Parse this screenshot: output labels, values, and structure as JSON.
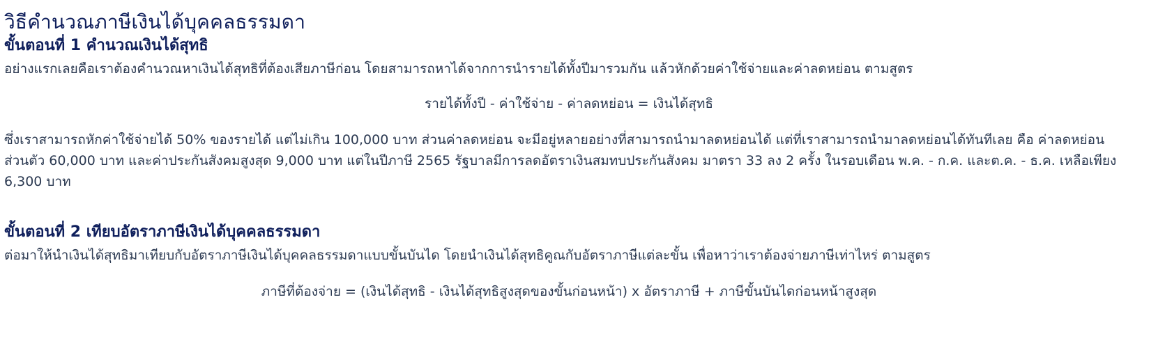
{
  "title": "วิธีคำนวณภาษีเงินได้บุคคลธรรมดา",
  "step1": {
    "heading": "ขั้นตอนที่ 1 คำนวณเงินได้สุทธิ",
    "intro": "อย่างแรกเลยคือเราต้องคำนวณหาเงินได้สุทธิที่ต้องเสียภาษีก่อน โดยสามารถหาได้จากการนำรายได้ทั้งปีมารวมกัน แล้วหักด้วยค่าใช้จ่ายและค่าลดหย่อน ตามสูตร",
    "formula": "รายได้ทั้งปี - ค่าใช้จ่าย - ค่าลดหย่อน = เงินได้สุทธิ",
    "detail_line1": "ซึ่งเราสามารถหักค่าใช้จ่ายได้ 50% ของรายได้ แต่ไม่เกิน 100,000 บาท ส่วนค่าลดหย่อน จะมีอยู่หลายอย่างที่สามารถนำมาลดหย่อนได้ แต่ที่เราสามารถนำมาลดหย่อนได้ทันทีเลย คือ ค่าลดหย่อน",
    "detail_line2": "ส่วนตัว 60,000 บาท และค่าประกันสังคมสูงสุด 9,000 บาท แต่ในปีภาษี 2565 รัฐบาลมีการลดอัตราเงินสมทบประกันสังคม มาตรา 33 ลง 2 ครั้ง ในรอบเดือน พ.ค. - ก.ค. และต.ค. - ธ.ค. เหลือเพียง",
    "detail_line3": "6,300 บาท"
  },
  "step2": {
    "heading": "ขั้นตอนที่ 2 เทียบอัตราภาษีเงินได้บุคคลธรรมดา",
    "intro": "ต่อมาให้นำเงินได้สุทธิมาเทียบกับอัตราภาษีเงินได้บุคคลธรรมดาแบบขั้นบันได โดยนำเงินได้สุทธิคูณกับอัตราภาษีแต่ละขั้น เพื่อหาว่าเราต้องจ่ายภาษีเท่าไหร่ ตามสูตร",
    "formula": "ภาษีที่ต้องจ่าย = (เงินได้สุทธิ - เงินได้สุทธิสูงสุดของขั้นก่อนหน้า) x อัตราภาษี + ภาษีขั้นบันไดก่อนหน้าสูงสุด"
  },
  "colors": {
    "heading": "#0f1f5c",
    "body": "#2c3a52",
    "background": "#ffffff"
  }
}
